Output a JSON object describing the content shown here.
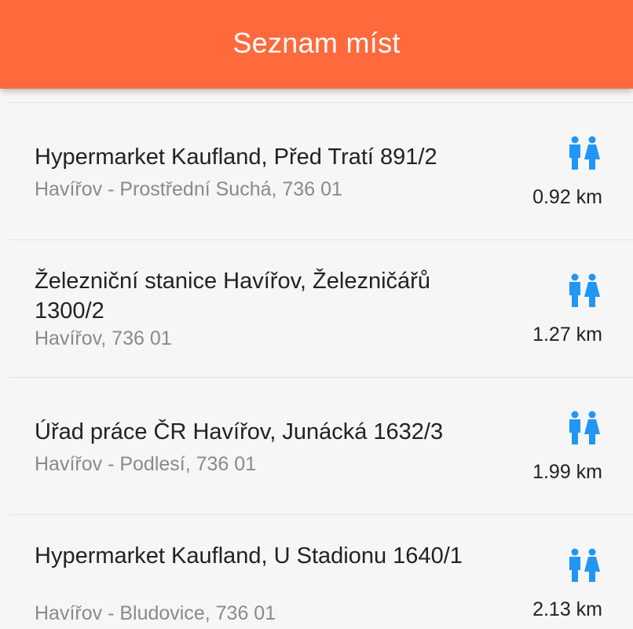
{
  "appbar": {
    "title": "Seznam míst",
    "color": "#ff6a3d"
  },
  "places": [
    {
      "name": "Hypermarket Kaufland, Před Tratí 891/2",
      "address": "Havířov - Prostřední Suchá, 736 01",
      "distance": "0.92 km",
      "icon": "restroom-icon"
    },
    {
      "name": "Železniční stanice Havířov, Železničářů 1300/2",
      "address": "Havířov, 736 01",
      "distance": "1.27 km",
      "icon": "restroom-icon"
    },
    {
      "name": "Úřad práce ČR Havířov, Junácká 1632/3",
      "address": "Havířov - Podlesí, 736 01",
      "distance": "1.99 km",
      "icon": "restroom-icon"
    },
    {
      "name": "Hypermarket Kaufland, U Stadionu 1640/1",
      "address": "Havířov - Bludovice, 736 01",
      "distance": "2.13 km",
      "icon": "restroom-icon"
    }
  ],
  "icon_color": "#2196f3"
}
